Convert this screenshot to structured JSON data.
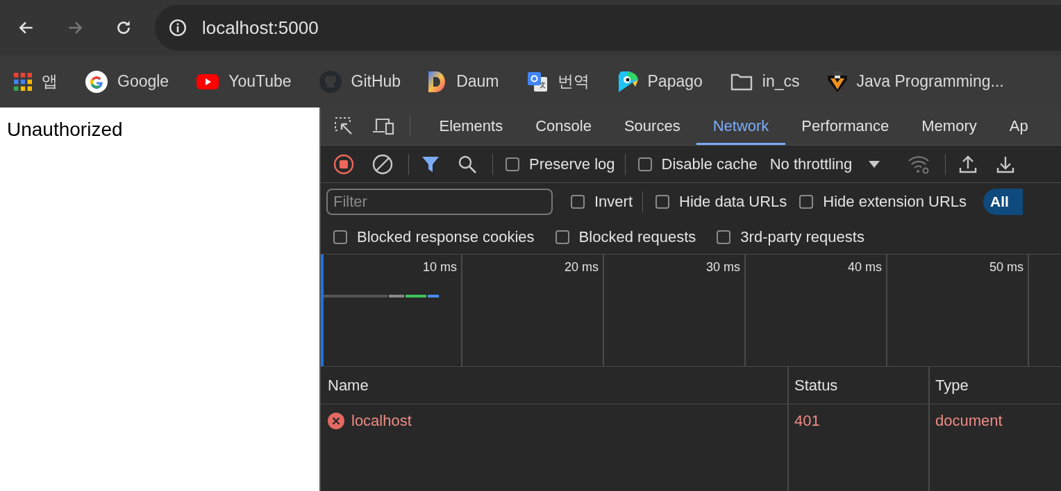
{
  "browser": {
    "back_enabled": true,
    "forward_enabled": false,
    "url": "localhost:5000"
  },
  "bookmarks": [
    {
      "label": "앱",
      "kind": "apps"
    },
    {
      "label": "Google",
      "kind": "google"
    },
    {
      "label": "YouTube",
      "kind": "youtube"
    },
    {
      "label": "GitHub",
      "kind": "github"
    },
    {
      "label": "Daum",
      "kind": "daum"
    },
    {
      "label": "번역",
      "kind": "translate"
    },
    {
      "label": "Papago",
      "kind": "papago"
    },
    {
      "label": "in_cs",
      "kind": "folder"
    },
    {
      "label": "Java Programming...",
      "kind": "java"
    }
  ],
  "page": {
    "text": "Unauthorized"
  },
  "devtools": {
    "tabs": [
      {
        "label": "Elements",
        "selected": false
      },
      {
        "label": "Console",
        "selected": false
      },
      {
        "label": "Sources",
        "selected": false
      },
      {
        "label": "Network",
        "selected": true
      },
      {
        "label": "Performance",
        "selected": false
      },
      {
        "label": "Memory",
        "selected": false
      },
      {
        "label": "Ap",
        "selected": false
      }
    ],
    "recording": true,
    "filter_shown": true,
    "toolbar_checks": [
      {
        "label": "Preserve log",
        "checked": false
      },
      {
        "label": "Disable cache",
        "checked": false
      }
    ],
    "throttling": "No throttling",
    "filter": {
      "placeholder": "Filter"
    },
    "filter_checks": [
      {
        "label": "Invert",
        "checked": false
      },
      {
        "label": "Hide data URLs",
        "checked": false
      },
      {
        "label": "Hide extension URLs",
        "checked": false
      }
    ],
    "type_button": {
      "label": "All",
      "selected": true
    },
    "more_filters": [
      {
        "label": "Blocked response cookies",
        "checked": false
      },
      {
        "label": "Blocked requests",
        "checked": false
      },
      {
        "label": "3rd-party requests",
        "checked": false
      }
    ],
    "overview": {
      "ticks": [
        "10 ms",
        "20 ms",
        "30 ms",
        "40 ms",
        "50 ms"
      ]
    },
    "table": {
      "columns": [
        "Name",
        "Status",
        "Type"
      ],
      "rows": [
        {
          "name": "localhost",
          "status": "401",
          "type": "document",
          "error": true
        }
      ]
    }
  }
}
